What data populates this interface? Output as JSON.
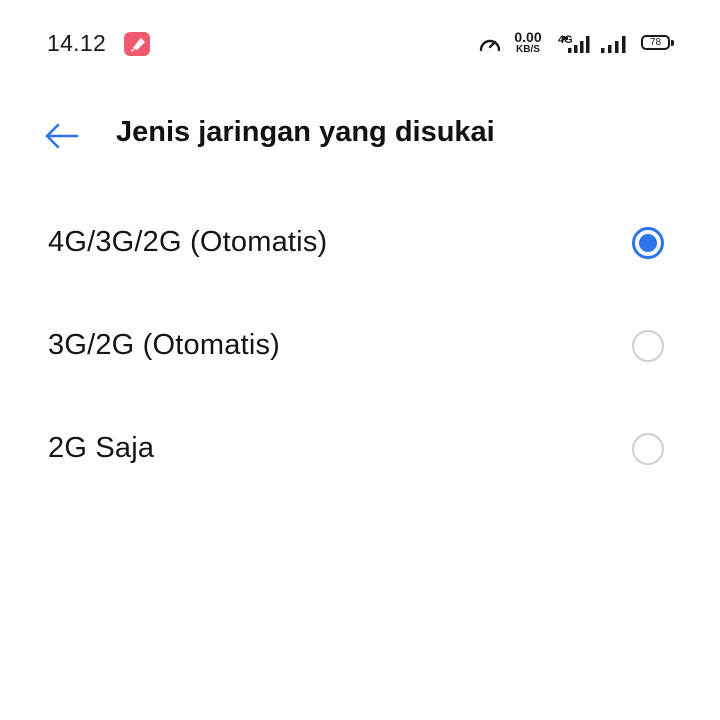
{
  "status_bar": {
    "time": "14.12",
    "speed_value": "0.00",
    "speed_unit": "KB/S",
    "network_type": "4G",
    "battery_level": "78"
  },
  "header": {
    "title": "Jenis jaringan yang disukai"
  },
  "options": [
    {
      "label": "4G/3G/2G (Otomatis)",
      "selected": true
    },
    {
      "label": "3G/2G (Otomatis)",
      "selected": false
    },
    {
      "label": "2G Saja",
      "selected": false
    }
  ],
  "colors": {
    "accent": "#2f74ec",
    "notification_icon": "#f05a6e",
    "radio_unselected": "#cfcfcf"
  },
  "icons": {
    "back": "arrow-left-icon",
    "notification": "app-notification-icon",
    "speed": "speedometer-icon",
    "signal": "cell-signal-icon",
    "battery": "battery-icon"
  }
}
